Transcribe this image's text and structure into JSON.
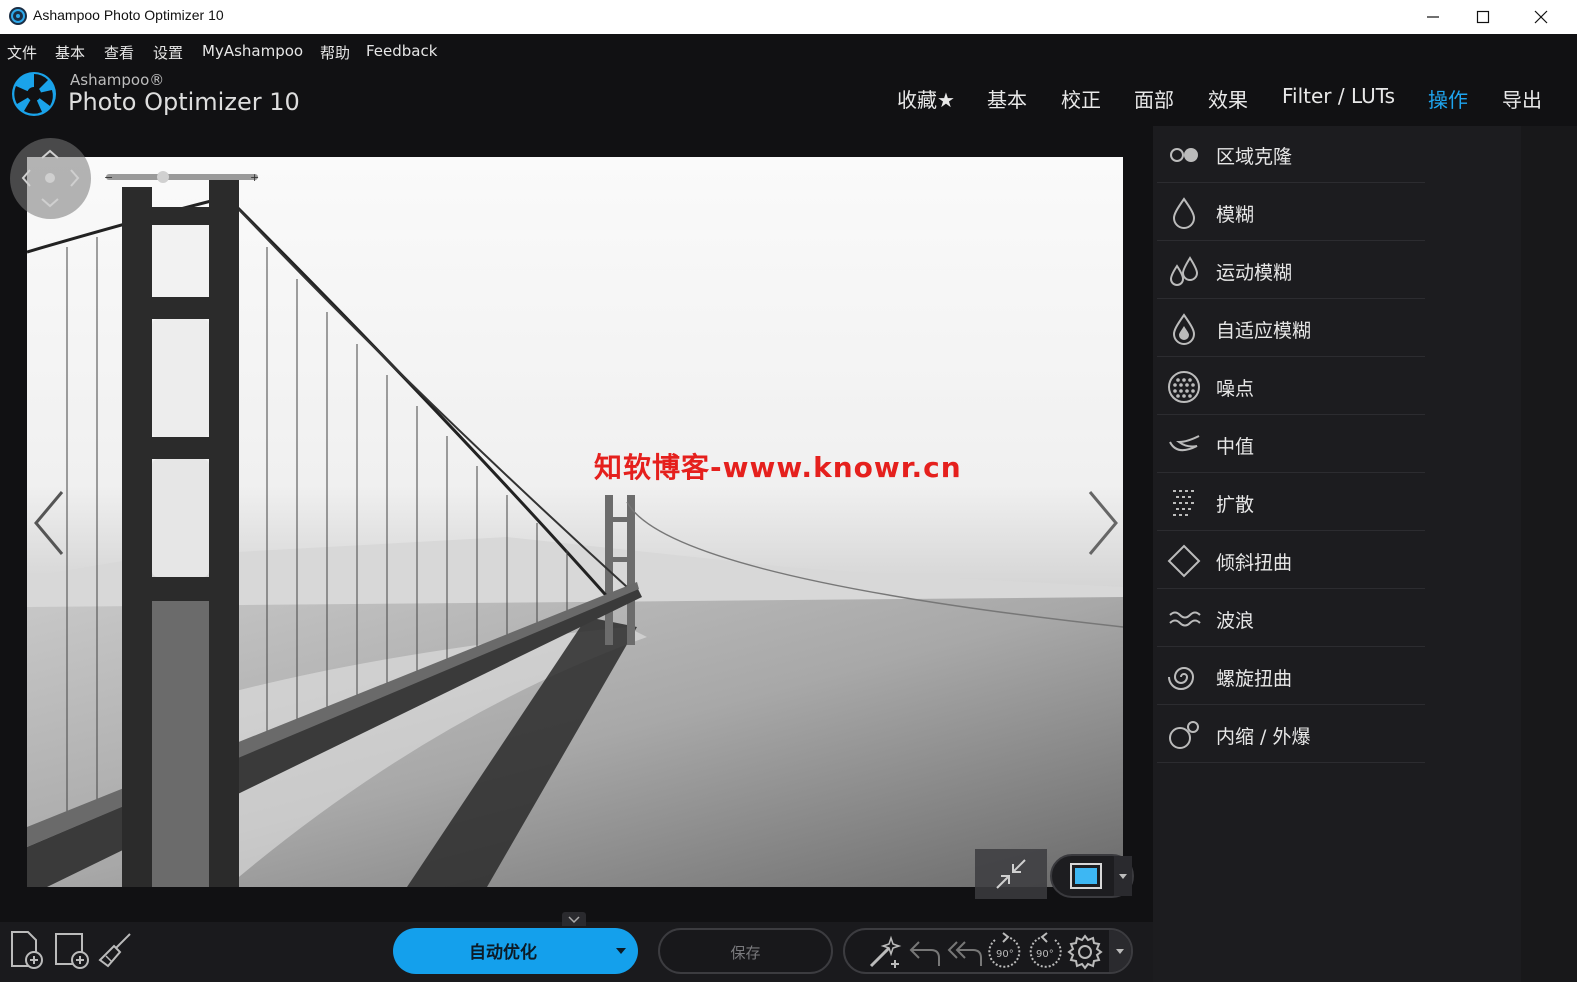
{
  "window": {
    "title": "Ashampoo Photo Optimizer 10",
    "controls": [
      "minimize",
      "maximize",
      "close"
    ]
  },
  "menu": [
    "文件",
    "基本",
    "查看",
    "设置",
    "MyAshampoo",
    "帮助",
    "Feedback"
  ],
  "logo": {
    "brand": "Ashampoo®",
    "product": "Photo Optimizer 10"
  },
  "tabs": [
    {
      "label": "收藏★",
      "active": false
    },
    {
      "label": "基本",
      "active": false
    },
    {
      "label": "校正",
      "active": false
    },
    {
      "label": "面部",
      "active": false
    },
    {
      "label": "效果",
      "active": false
    },
    {
      "label": "Filter / LUTs",
      "active": false
    },
    {
      "label": "操作",
      "active": true
    },
    {
      "label": "导出",
      "active": false
    }
  ],
  "watermark": "知软博客-www.knowr.cn",
  "tools": [
    {
      "label": "区域克隆",
      "icon": "clone-icon"
    },
    {
      "label": "模糊",
      "icon": "blur-drop-icon"
    },
    {
      "label": "运动模糊",
      "icon": "motion-blur-icon"
    },
    {
      "label": "自适应模糊",
      "icon": "adaptive-blur-icon"
    },
    {
      "label": "噪点",
      "icon": "noise-icon"
    },
    {
      "label": "中值",
      "icon": "median-icon"
    },
    {
      "label": "扩散",
      "icon": "diffuse-icon"
    },
    {
      "label": "倾斜扭曲",
      "icon": "skew-icon"
    },
    {
      "label": "波浪",
      "icon": "wave-icon"
    },
    {
      "label": "螺旋扭曲",
      "icon": "swirl-icon"
    },
    {
      "label": "内缩 / 外爆",
      "icon": "pinch-icon"
    }
  ],
  "bottom": {
    "auto_optimize": "自动优化",
    "save": "保存",
    "rotate_left_label": "90°",
    "rotate_right_label": "90°"
  },
  "colors": {
    "accent": "#1ea4ee",
    "auto_button": "#14a0ec",
    "watermark": "#e5201d",
    "background": "#111113"
  }
}
